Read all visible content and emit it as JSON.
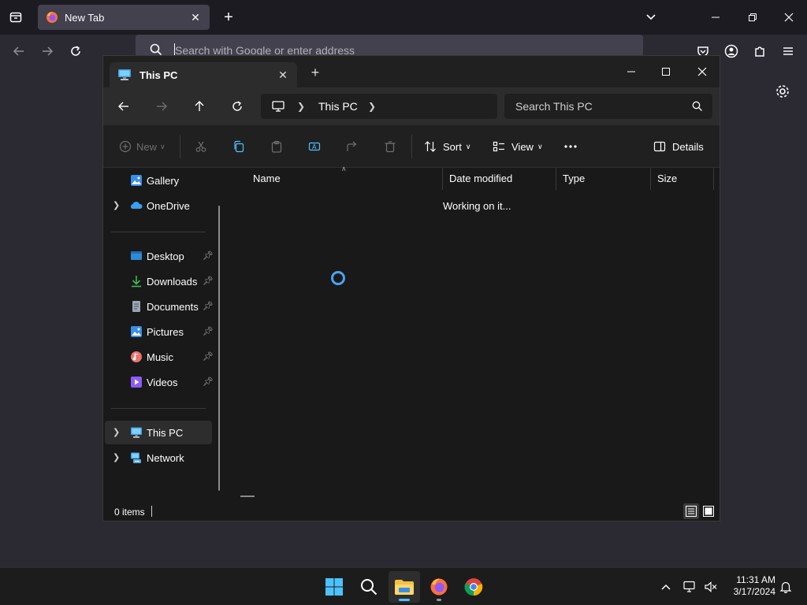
{
  "firefox": {
    "tab_title": "New Tab",
    "urlbar_placeholder": "Search with Google or enter address"
  },
  "explorer": {
    "tab_title": "This PC",
    "breadcrumb": "This PC",
    "search_placeholder": "Search This PC",
    "toolbar": {
      "new_label": "New",
      "sort_label": "Sort",
      "view_label": "View",
      "details_label": "Details"
    },
    "sidebar": {
      "gallery": "Gallery",
      "onedrive": "OneDrive",
      "desktop": "Desktop",
      "downloads": "Downloads",
      "documents": "Documents",
      "pictures": "Pictures",
      "music": "Music",
      "videos": "Videos",
      "this_pc": "This PC",
      "network": "Network"
    },
    "columns": {
      "name": "Name",
      "date_modified": "Date modified",
      "type": "Type",
      "size": "Size"
    },
    "loading_text": "Working on it...",
    "status_count": "0 items"
  },
  "taskbar": {
    "time": "11:31 AM",
    "date": "3/17/2024"
  }
}
